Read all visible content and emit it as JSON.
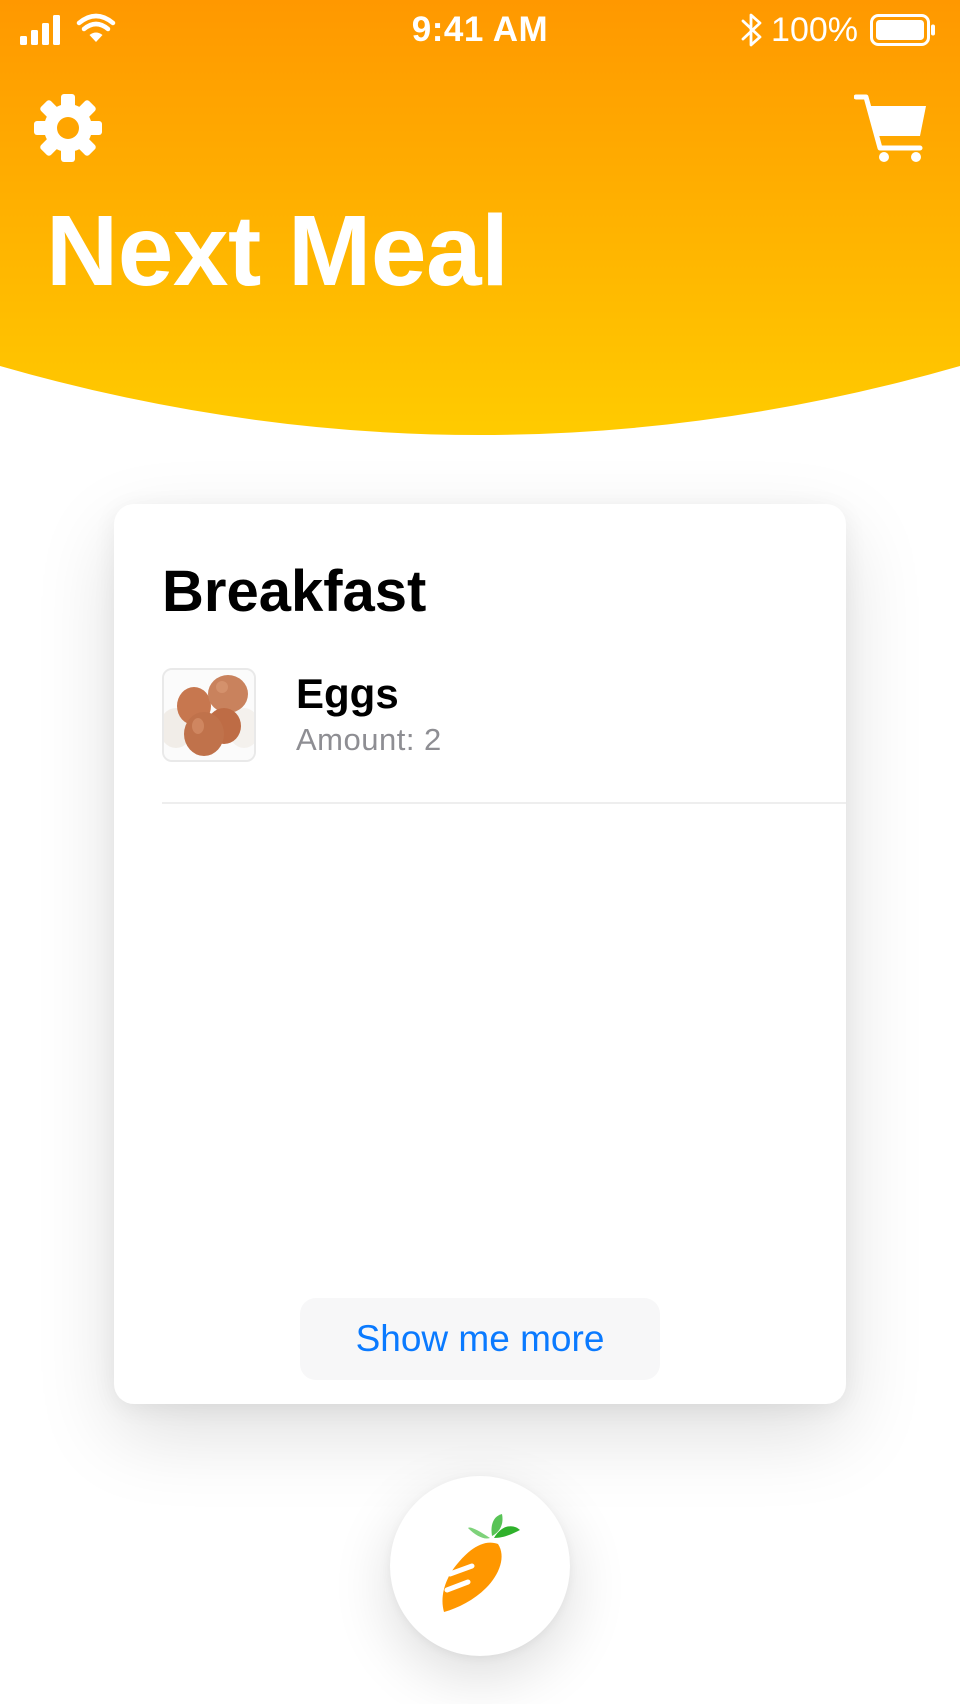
{
  "status_bar": {
    "time": "9:41 AM",
    "battery_percent": "100%",
    "icons": [
      "signal-icon",
      "wifi-icon",
      "bluetooth-icon",
      "battery-icon"
    ]
  },
  "header": {
    "title": "Next Meal",
    "left_icon": "gear-icon",
    "right_icon": "cart-icon",
    "gradient_top": "#FF9900",
    "gradient_bottom": "#FFCC00"
  },
  "meal_card": {
    "title": "Breakfast",
    "items": [
      {
        "name": "Eggs",
        "amount": "Amount: 2",
        "thumbnail": "eggs-image"
      }
    ],
    "more_button": "Show me more"
  },
  "fab": {
    "icon": "carrot-icon"
  },
  "colors": {
    "accent_blue": "#0A7AFF",
    "secondary_text": "#8E8E93"
  }
}
